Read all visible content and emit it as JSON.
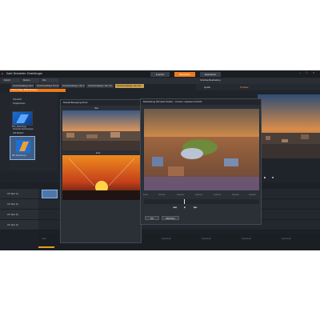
{
  "menu": {
    "items": [
      "Datei",
      "Bearbeiten",
      "Einstellungen"
    ]
  },
  "top_tabs": [
    {
      "label": "Importer"
    },
    {
      "label": "Bearbeiten"
    },
    {
      "label": "Exportieren"
    }
  ],
  "library": {
    "tabs": [
      "Zuletzt",
      "Medien",
      "Alle"
    ],
    "collections": [
      "Vorschaudialoge (4k-Video)",
      "Vorschaudialoge Pinnacle",
      "Vorschaudialoge: Hier Sie...",
      "Vorschaudialoge: Hier Sie...",
      "Vorschaudialoge: Hier Sie..."
    ],
    "path_label": "Ordner Home: Bildbearbeitung"
  },
  "folders": {
    "items": [
      "Übersicht",
      "Projektordner",
      "Pinnacle Sammlungen",
      "Alle Medien"
    ]
  },
  "assets": [
    {
      "label": "Pinn_Nutzer2.jpg"
    },
    {
      "label": "Bild: Bearbeitung"
    }
  ],
  "right_panel": {
    "header": "Vorschau Bearbeitung",
    "tab_source": "Quelle",
    "tab_timeline": "Timeline"
  },
  "dialog_pan": {
    "title": "Mosaik-Bewegung Zoom",
    "label_start": "Start",
    "label_end": "Ende"
  },
  "dialog_main": {
    "title": "Bearbeitung (Pinnacle Studio) – Fenster: anpassen Ansicht",
    "ticks": [
      "00:00",
      "00:00:01",
      "00:00:02",
      "00:00:03",
      "00:00:04",
      "00:00:05",
      "00:00:06"
    ],
    "ok_label": "OK",
    "cancel_label": "Abbrechen"
  },
  "tracks": [
    {
      "label": "A/V Spur (1)"
    },
    {
      "label": "A/V Spur (2)"
    },
    {
      "label": "A/V Spur (3)"
    },
    {
      "label": "A/V Spur (4)"
    }
  ],
  "ruler": {
    "ticks": [
      "00:00",
      "00:00:10:00",
      "00:00:20:00",
      "00:00:30:00",
      "00:00:40:00",
      "00:00:50:00",
      "00:01:00:00"
    ]
  },
  "colors": {
    "accent": "#f07b1c",
    "bg": "#1f232a",
    "panel": "#2b2f36"
  }
}
